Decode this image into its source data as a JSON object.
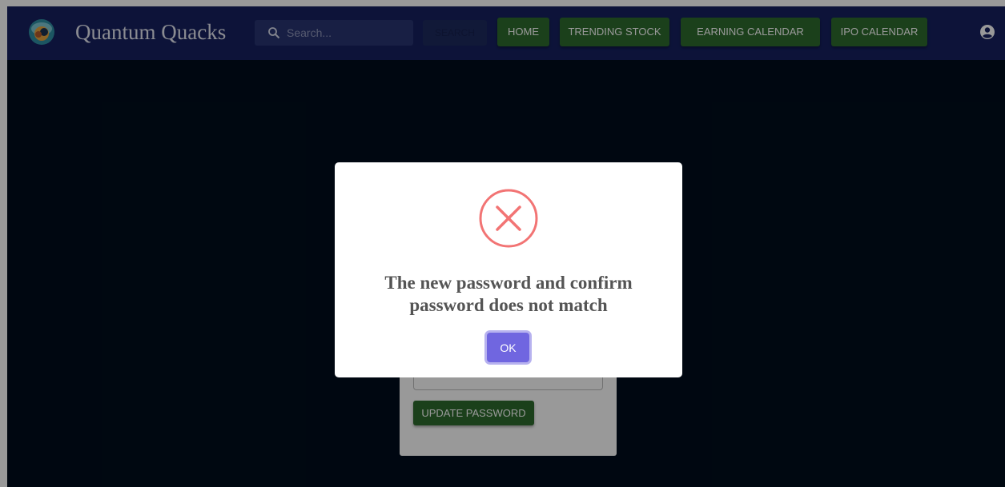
{
  "brand": {
    "name": "Quantum Quacks",
    "logo_icon": "duck-logo-icon"
  },
  "search": {
    "placeholder": "Search...",
    "value": "",
    "button_label": "SEARCH"
  },
  "nav": {
    "items": [
      {
        "label": "HOME"
      },
      {
        "label": "TRENDING STOCK"
      },
      {
        "label": "EARNING CALENDAR"
      },
      {
        "label": "IPO CALENDAR"
      }
    ],
    "account_icon": "account-circle-icon"
  },
  "form": {
    "confirm_value": "",
    "update_label": "UPDATE PASSWORD"
  },
  "dialog": {
    "icon": "error-x-icon",
    "message": "The new password and confirm password does not match",
    "ok_label": "OK"
  },
  "colors": {
    "navbar": "#162160",
    "page_background": "#000d1d",
    "nav_button": "#2e6b2d",
    "ok_button": "#7066e0",
    "error_icon": "#f27474"
  }
}
